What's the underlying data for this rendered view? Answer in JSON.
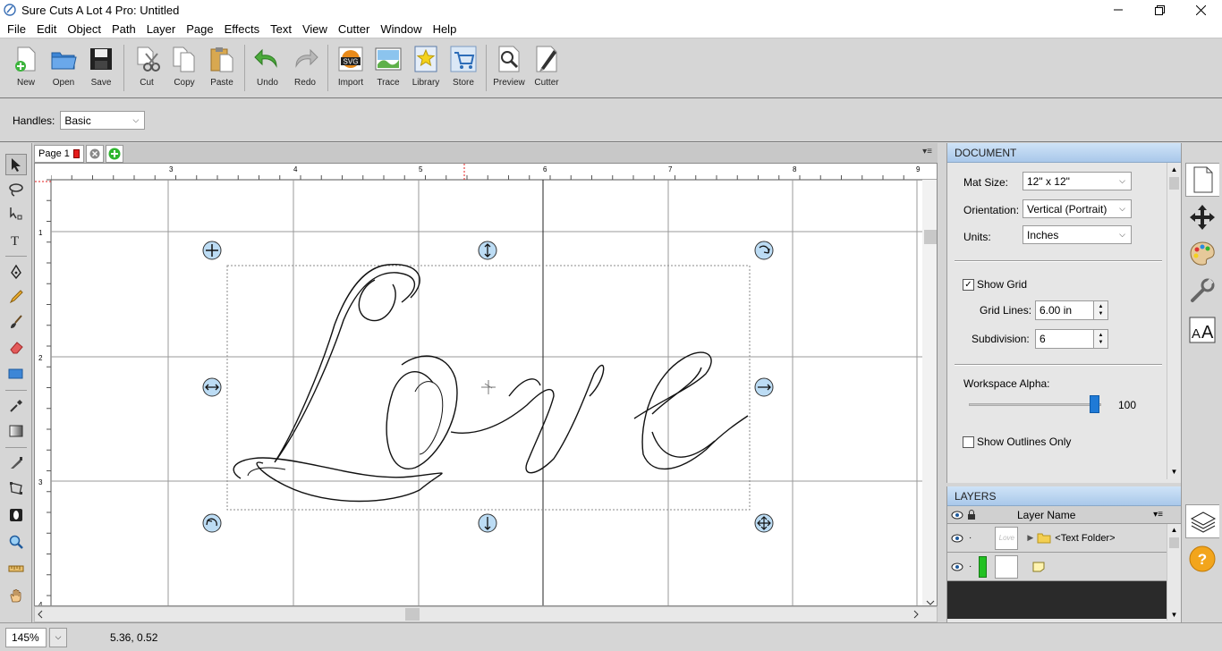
{
  "window": {
    "title": "Sure Cuts A Lot 4 Pro: Untitled",
    "controls": [
      "minimize",
      "restore",
      "close"
    ]
  },
  "menubar": {
    "items": [
      "File",
      "Edit",
      "Object",
      "Path",
      "Layer",
      "Page",
      "Effects",
      "Text",
      "View",
      "Cutter",
      "Window",
      "Help"
    ]
  },
  "toolbar": {
    "buttons": [
      {
        "label": "New",
        "icon": "new-document-icon"
      },
      {
        "label": "Open",
        "icon": "open-folder-icon"
      },
      {
        "label": "Save",
        "icon": "floppy-disk-icon"
      },
      {
        "label": "Cut",
        "icon": "scissors-icon"
      },
      {
        "label": "Copy",
        "icon": "copy-icon"
      },
      {
        "label": "Paste",
        "icon": "paste-icon"
      },
      {
        "label": "Undo",
        "icon": "undo-arrow-icon"
      },
      {
        "label": "Redo",
        "icon": "redo-arrow-icon"
      },
      {
        "label": "Import",
        "icon": "svg-import-icon"
      },
      {
        "label": "Trace",
        "icon": "trace-image-icon"
      },
      {
        "label": "Library",
        "icon": "star-library-icon"
      },
      {
        "label": "Store",
        "icon": "shopping-cart-icon"
      },
      {
        "label": "Preview",
        "icon": "magnifier-preview-icon"
      },
      {
        "label": "Cutter",
        "icon": "cutter-blade-icon"
      }
    ]
  },
  "handles": {
    "label": "Handles:",
    "value": "Basic"
  },
  "left_tools": [
    "select-arrow-icon",
    "lasso-icon",
    "node-edit-icon",
    "text-tool-icon",
    "pen-tool-icon",
    "pencil-icon",
    "brush-icon",
    "eraser-icon",
    "rectangle-tool-icon",
    "eyedropper-icon",
    "gradient-box-icon",
    "knife-icon",
    "path-tool-icon",
    "contour-icon",
    "zoom-tool-icon",
    "ruler-tool-icon",
    "hand-pan-icon"
  ],
  "page_tabs": {
    "tab_label": "Page 1"
  },
  "ruler": {
    "top_numbers": [
      "3",
      "4",
      "5",
      "6",
      "7",
      "8",
      "9"
    ],
    "left_numbers": [
      "1",
      "2",
      "3",
      "4"
    ]
  },
  "canvas": {
    "artwork_text": "Love"
  },
  "status": {
    "zoom": "145%",
    "coordinates": "5.36, 0.52"
  },
  "document_panel": {
    "header": "DOCUMENT",
    "mat_size_label": "Mat Size:",
    "mat_size_value": "12\" x 12\"",
    "orientation_label": "Orientation:",
    "orientation_value": "Vertical (Portrait)",
    "units_label": "Units:",
    "units_value": "Inches",
    "show_grid_label": "Show Grid",
    "show_grid_checked": true,
    "grid_lines_label": "Grid Lines:",
    "grid_lines_value": "6.00 in",
    "subdivision_label": "Subdivision:",
    "subdivision_value": "6",
    "workspace_alpha_label": "Workspace Alpha:",
    "workspace_alpha_value": "100",
    "show_outlines_label": "Show Outlines Only",
    "show_outlines_checked": false
  },
  "layers_panel": {
    "header": "LAYERS",
    "column_name": "Layer Name",
    "rows": [
      {
        "name": "<Text Folder>",
        "thumb_text": "Love",
        "color": "",
        "type": "folder"
      },
      {
        "name": "",
        "thumb_text": "",
        "color": "#22c122",
        "type": "note"
      }
    ]
  },
  "right_bar": [
    "document-page-icon",
    "move-arrows-icon",
    "color-palette-icon",
    "wrench-icon",
    "text-style-icon",
    "layers-icon",
    "help-question-icon"
  ],
  "colors": {
    "panel_header": "#a9c8ea",
    "layer_green": "#22c122",
    "page_red": "#e41b1b",
    "add_green": "#2fb52f"
  }
}
